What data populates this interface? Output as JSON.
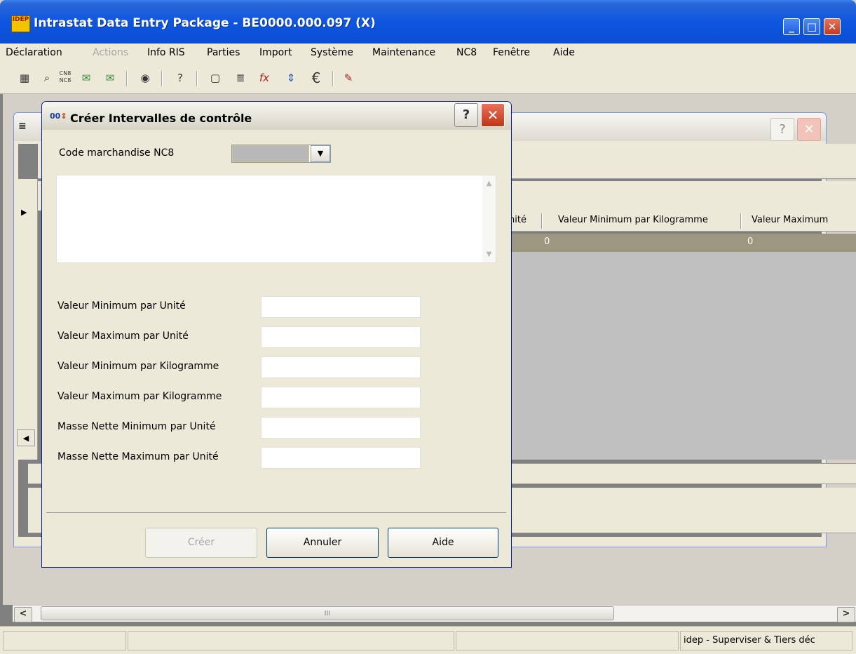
{
  "app": {
    "title": "Intrastat Data Entry Package - BE0000.000.097 (X)",
    "logo_text": "IDEP",
    "minimize": "_",
    "maximize": "□",
    "close": "✕"
  },
  "menu": [
    {
      "label": "Déclaration",
      "disabled": false
    },
    {
      "label": "Actions",
      "disabled": true
    },
    {
      "label": "Info RIS",
      "disabled": false
    },
    {
      "label": "Parties",
      "disabled": false
    },
    {
      "label": "Import",
      "disabled": false
    },
    {
      "label": "Système",
      "disabled": false
    },
    {
      "label": "Maintenance",
      "disabled": false
    },
    {
      "label": "NC8",
      "disabled": false
    },
    {
      "label": "Fenêtre",
      "disabled": false
    },
    {
      "label": "Aide",
      "disabled": false
    }
  ],
  "toolbar": {
    "icons": [
      "grid-icon",
      "binoculars-icon",
      "cn8-nc8-icon",
      "envelope-in-icon",
      "envelope-out-icon",
      "camera-icon",
      "help-icon",
      "new-document-icon",
      "layers-icon",
      "function-icon",
      "interval-icon",
      "euro-icon",
      "tools-icon"
    ],
    "cn8_text": "CN8\nNC8",
    "fx_text": "fx",
    "euro_text": "€"
  },
  "background_window": {
    "help": "?",
    "close": "✕",
    "grid_headers": [
      "nité",
      "Valeur Minimum par Kilogramme",
      "Valeur Maximum"
    ],
    "grid_row": [
      "0",
      "0"
    ]
  },
  "dialog": {
    "title": "Créer Intervalles de contrôle",
    "icon_text": "00",
    "help": "?",
    "close": "✕",
    "nc8_label": "Code marchandise NC8",
    "nc8_value": "",
    "fields": [
      {
        "label": "Valeur Minimum par Unité",
        "value": ""
      },
      {
        "label": "Valeur Maximum par Unité",
        "value": ""
      },
      {
        "label": "Valeur Minimum par Kilogramme",
        "value": ""
      },
      {
        "label": "Valeur Maximum par Kilogramme",
        "value": ""
      },
      {
        "label": "Masse Nette Minimum par Unité",
        "value": ""
      },
      {
        "label": "Masse Nette Maximum par Unité",
        "value": ""
      }
    ],
    "buttons": {
      "create": "Créer",
      "cancel": "Annuler",
      "help": "Aide"
    }
  },
  "scrollbar": {
    "left": "<",
    "right": ">",
    "grip": "III"
  },
  "status": {
    "panels": [
      "",
      "",
      "",
      "idep - Superviser & Tiers déc"
    ]
  }
}
